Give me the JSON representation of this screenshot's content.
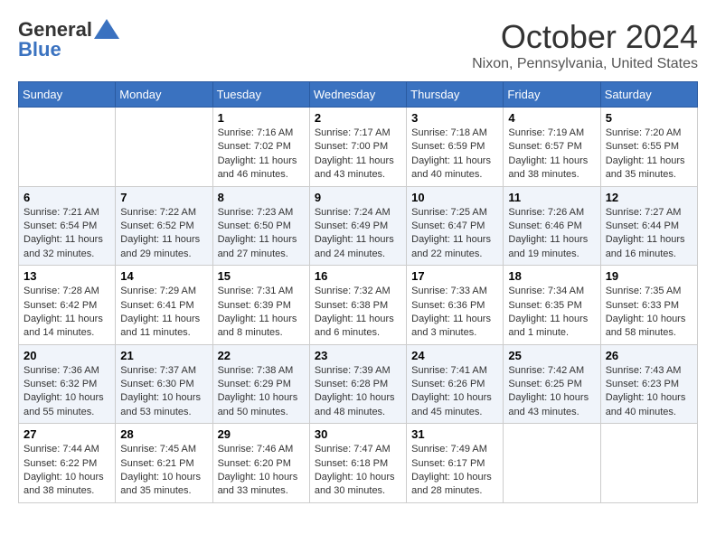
{
  "header": {
    "logo_general": "General",
    "logo_blue": "Blue",
    "month_title": "October 2024",
    "location": "Nixon, Pennsylvania, United States"
  },
  "weekdays": [
    "Sunday",
    "Monday",
    "Tuesday",
    "Wednesday",
    "Thursday",
    "Friday",
    "Saturday"
  ],
  "weeks": [
    [
      {
        "day": "",
        "sunrise": "",
        "sunset": "",
        "daylight": ""
      },
      {
        "day": "",
        "sunrise": "",
        "sunset": "",
        "daylight": ""
      },
      {
        "day": "1",
        "sunrise": "Sunrise: 7:16 AM",
        "sunset": "Sunset: 7:02 PM",
        "daylight": "Daylight: 11 hours and 46 minutes."
      },
      {
        "day": "2",
        "sunrise": "Sunrise: 7:17 AM",
        "sunset": "Sunset: 7:00 PM",
        "daylight": "Daylight: 11 hours and 43 minutes."
      },
      {
        "day": "3",
        "sunrise": "Sunrise: 7:18 AM",
        "sunset": "Sunset: 6:59 PM",
        "daylight": "Daylight: 11 hours and 40 minutes."
      },
      {
        "day": "4",
        "sunrise": "Sunrise: 7:19 AM",
        "sunset": "Sunset: 6:57 PM",
        "daylight": "Daylight: 11 hours and 38 minutes."
      },
      {
        "day": "5",
        "sunrise": "Sunrise: 7:20 AM",
        "sunset": "Sunset: 6:55 PM",
        "daylight": "Daylight: 11 hours and 35 minutes."
      }
    ],
    [
      {
        "day": "6",
        "sunrise": "Sunrise: 7:21 AM",
        "sunset": "Sunset: 6:54 PM",
        "daylight": "Daylight: 11 hours and 32 minutes."
      },
      {
        "day": "7",
        "sunrise": "Sunrise: 7:22 AM",
        "sunset": "Sunset: 6:52 PM",
        "daylight": "Daylight: 11 hours and 29 minutes."
      },
      {
        "day": "8",
        "sunrise": "Sunrise: 7:23 AM",
        "sunset": "Sunset: 6:50 PM",
        "daylight": "Daylight: 11 hours and 27 minutes."
      },
      {
        "day": "9",
        "sunrise": "Sunrise: 7:24 AM",
        "sunset": "Sunset: 6:49 PM",
        "daylight": "Daylight: 11 hours and 24 minutes."
      },
      {
        "day": "10",
        "sunrise": "Sunrise: 7:25 AM",
        "sunset": "Sunset: 6:47 PM",
        "daylight": "Daylight: 11 hours and 22 minutes."
      },
      {
        "day": "11",
        "sunrise": "Sunrise: 7:26 AM",
        "sunset": "Sunset: 6:46 PM",
        "daylight": "Daylight: 11 hours and 19 minutes."
      },
      {
        "day": "12",
        "sunrise": "Sunrise: 7:27 AM",
        "sunset": "Sunset: 6:44 PM",
        "daylight": "Daylight: 11 hours and 16 minutes."
      }
    ],
    [
      {
        "day": "13",
        "sunrise": "Sunrise: 7:28 AM",
        "sunset": "Sunset: 6:42 PM",
        "daylight": "Daylight: 11 hours and 14 minutes."
      },
      {
        "day": "14",
        "sunrise": "Sunrise: 7:29 AM",
        "sunset": "Sunset: 6:41 PM",
        "daylight": "Daylight: 11 hours and 11 minutes."
      },
      {
        "day": "15",
        "sunrise": "Sunrise: 7:31 AM",
        "sunset": "Sunset: 6:39 PM",
        "daylight": "Daylight: 11 hours and 8 minutes."
      },
      {
        "day": "16",
        "sunrise": "Sunrise: 7:32 AM",
        "sunset": "Sunset: 6:38 PM",
        "daylight": "Daylight: 11 hours and 6 minutes."
      },
      {
        "day": "17",
        "sunrise": "Sunrise: 7:33 AM",
        "sunset": "Sunset: 6:36 PM",
        "daylight": "Daylight: 11 hours and 3 minutes."
      },
      {
        "day": "18",
        "sunrise": "Sunrise: 7:34 AM",
        "sunset": "Sunset: 6:35 PM",
        "daylight": "Daylight: 11 hours and 1 minute."
      },
      {
        "day": "19",
        "sunrise": "Sunrise: 7:35 AM",
        "sunset": "Sunset: 6:33 PM",
        "daylight": "Daylight: 10 hours and 58 minutes."
      }
    ],
    [
      {
        "day": "20",
        "sunrise": "Sunrise: 7:36 AM",
        "sunset": "Sunset: 6:32 PM",
        "daylight": "Daylight: 10 hours and 55 minutes."
      },
      {
        "day": "21",
        "sunrise": "Sunrise: 7:37 AM",
        "sunset": "Sunset: 6:30 PM",
        "daylight": "Daylight: 10 hours and 53 minutes."
      },
      {
        "day": "22",
        "sunrise": "Sunrise: 7:38 AM",
        "sunset": "Sunset: 6:29 PM",
        "daylight": "Daylight: 10 hours and 50 minutes."
      },
      {
        "day": "23",
        "sunrise": "Sunrise: 7:39 AM",
        "sunset": "Sunset: 6:28 PM",
        "daylight": "Daylight: 10 hours and 48 minutes."
      },
      {
        "day": "24",
        "sunrise": "Sunrise: 7:41 AM",
        "sunset": "Sunset: 6:26 PM",
        "daylight": "Daylight: 10 hours and 45 minutes."
      },
      {
        "day": "25",
        "sunrise": "Sunrise: 7:42 AM",
        "sunset": "Sunset: 6:25 PM",
        "daylight": "Daylight: 10 hours and 43 minutes."
      },
      {
        "day": "26",
        "sunrise": "Sunrise: 7:43 AM",
        "sunset": "Sunset: 6:23 PM",
        "daylight": "Daylight: 10 hours and 40 minutes."
      }
    ],
    [
      {
        "day": "27",
        "sunrise": "Sunrise: 7:44 AM",
        "sunset": "Sunset: 6:22 PM",
        "daylight": "Daylight: 10 hours and 38 minutes."
      },
      {
        "day": "28",
        "sunrise": "Sunrise: 7:45 AM",
        "sunset": "Sunset: 6:21 PM",
        "daylight": "Daylight: 10 hours and 35 minutes."
      },
      {
        "day": "29",
        "sunrise": "Sunrise: 7:46 AM",
        "sunset": "Sunset: 6:20 PM",
        "daylight": "Daylight: 10 hours and 33 minutes."
      },
      {
        "day": "30",
        "sunrise": "Sunrise: 7:47 AM",
        "sunset": "Sunset: 6:18 PM",
        "daylight": "Daylight: 10 hours and 30 minutes."
      },
      {
        "day": "31",
        "sunrise": "Sunrise: 7:49 AM",
        "sunset": "Sunset: 6:17 PM",
        "daylight": "Daylight: 10 hours and 28 minutes."
      },
      {
        "day": "",
        "sunrise": "",
        "sunset": "",
        "daylight": ""
      },
      {
        "day": "",
        "sunrise": "",
        "sunset": "",
        "daylight": ""
      }
    ]
  ]
}
